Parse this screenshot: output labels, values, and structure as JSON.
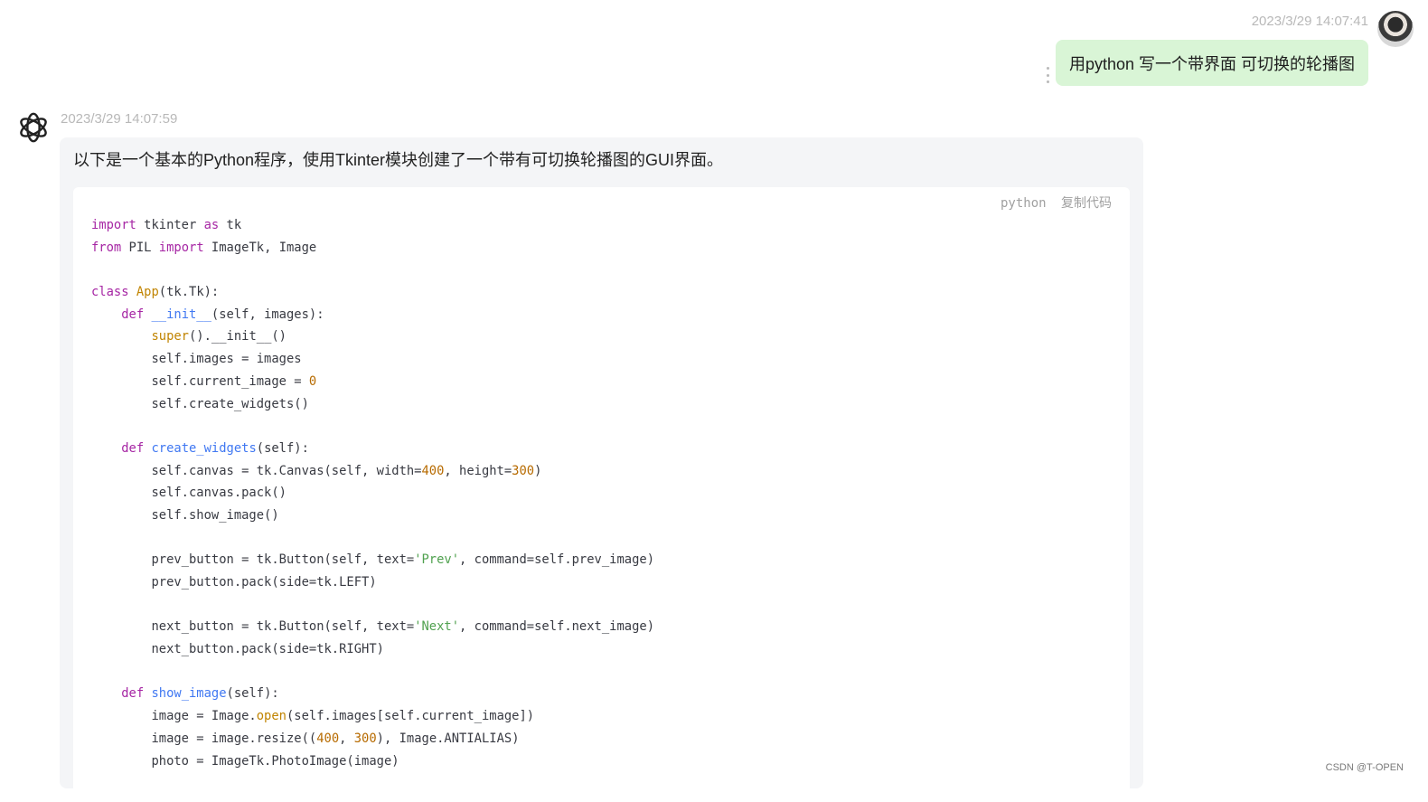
{
  "user_message": {
    "timestamp": "2023/3/29 14:07:41",
    "text": "用python 写一个带界面 可切换的轮播图"
  },
  "assistant_message": {
    "timestamp": "2023/3/29 14:07:59",
    "intro": "以下是一个基本的Python程序，使用Tkinter模块创建了一个带有可切换轮播图的GUI界面。",
    "code": {
      "language": "python",
      "copy_label": "复制代码",
      "lines": [
        "import tkinter as tk",
        "from PIL import ImageTk, Image",
        "",
        "class App(tk.Tk):",
        "    def __init__(self, images):",
        "        super().__init__()",
        "        self.images = images",
        "        self.current_image = 0",
        "        self.create_widgets()",
        "",
        "    def create_widgets(self):",
        "        self.canvas = tk.Canvas(self, width=400, height=300)",
        "        self.canvas.pack()",
        "        self.show_image()",
        "",
        "        prev_button = tk.Button(self, text='Prev', command=self.prev_image)",
        "        prev_button.pack(side=tk.LEFT)",
        "",
        "        next_button = tk.Button(self, text='Next', command=self.next_image)",
        "        next_button.pack(side=tk.RIGHT)",
        "",
        "    def show_image(self):",
        "        image = Image.open(self.images[self.current_image])",
        "        image = image.resize((400, 300), Image.ANTIALIAS)",
        "        photo = ImageTk.PhotoImage(image)"
      ]
    }
  },
  "watermark": "CSDN @T-OPEN",
  "icons": {
    "user_avatar": "user-avatar",
    "assistant_logo": "openai-logo-icon",
    "more": "more-vertical-icon"
  },
  "colors": {
    "user_bubble": "#d9f5d6",
    "assistant_bubble": "#f4f5f7",
    "keyword": "#a626a4",
    "function": "#4078f2",
    "number": "#b76b01",
    "string": "#50a14f",
    "class_name": "#c18401"
  }
}
